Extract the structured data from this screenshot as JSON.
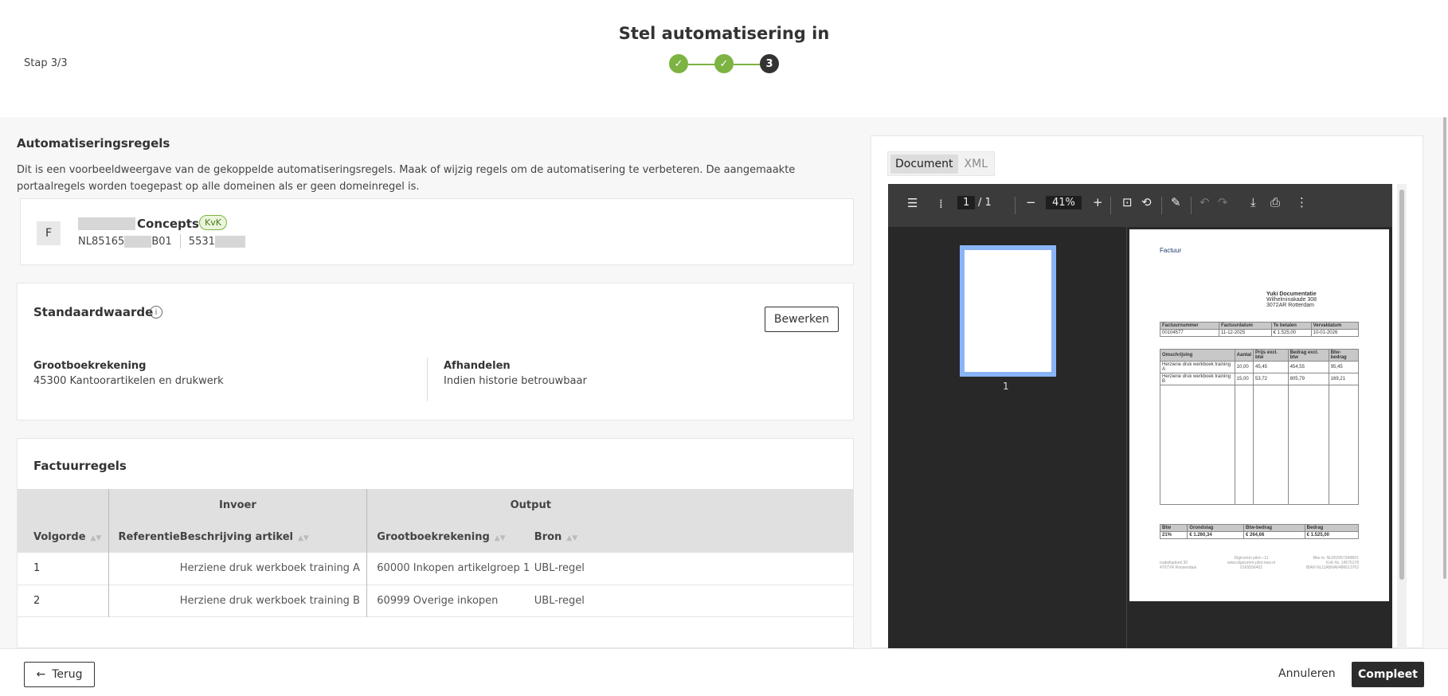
{
  "header": {
    "title": "Stel automatisering in",
    "step": "Stap 3/3",
    "stepper": [
      {
        "state": "done"
      },
      {
        "state": "done"
      },
      {
        "state": "current",
        "label": "3"
      }
    ]
  },
  "rules": {
    "title": "Automatiseringsregels",
    "description": "Dit is een voorbeeldweergave van de gekoppelde automatiseringsregels. Maak of wijzig regels om de automatisering te verbeteren. De aangemaakte portaalregels worden toegepast op alle domeinen als er geen domeinregel is."
  },
  "company": {
    "avatar": "F",
    "name": "Concepts",
    "badge": "KvK",
    "vat_prefix": "NL85165",
    "vat_suffix": "B01",
    "kvk_prefix": "5531"
  },
  "defaults": {
    "title": "Standaardwaarde",
    "edit_label": "Bewerken",
    "ledger_label": "Grootboekrekening",
    "ledger_value": "45300 Kantoorartikelen en drukwerk",
    "handling_label": "Afhandelen",
    "handling_value": "Indien historie betrouwbaar"
  },
  "lines": {
    "title": "Factuurregels",
    "group_input": "Invoer",
    "group_output": "Output",
    "columns": [
      "Volgorde",
      "Referentie",
      "Beschrijving artikel",
      "Grootboekrekening",
      "Bron"
    ],
    "rows": [
      {
        "order": "1",
        "reference": "",
        "description": "Herziene druk werkboek training A",
        "ledger": "60000 Inkopen artikelgroep 1",
        "source": "UBL-regel"
      },
      {
        "order": "2",
        "reference": "",
        "description": "Herziene druk werkboek training B",
        "ledger": "60999 Overige inkopen",
        "source": "UBL-regel"
      }
    ]
  },
  "viewer": {
    "tabs": [
      "Document",
      "XML"
    ],
    "active_tab": "Document",
    "page": "1",
    "page_total": "/ 1",
    "zoom": "41%",
    "thumb_label": "1"
  },
  "invoice": {
    "heading": "Factuur",
    "company": "Yuki Documentatie",
    "address1": "Wilhelminakade 308",
    "address2": "3072AR  Rotterdam",
    "meta_headers": [
      "Factuurnummer",
      "Factuurdatum",
      "Te betalen",
      "Vervaldatum"
    ],
    "meta_values": [
      "00104577",
      "11-12-2025",
      "€ 1.525,00",
      "10-01-2026"
    ],
    "line_headers": [
      "Omschrijving",
      "Aantal",
      "Prijs excl. btw",
      "Bedrag excl. btw",
      "Btw-bedrag"
    ],
    "line_rows": [
      [
        "Herziene druk werkboek training A",
        "10,00",
        "45,45",
        "454,55",
        "95,45"
      ],
      [
        "Herziene druk werkboek training B",
        "15,00",
        "53,72",
        "805,79",
        "169,21"
      ]
    ],
    "vat_headers": [
      "Btw",
      "Grondslag",
      "Btw-bedrag",
      "Bedrag"
    ],
    "vat_values": [
      "21%",
      "€ 1.260,34",
      "€ 264,66",
      "€ 1.525,00"
    ],
    "footer_left": [
      "Isabelladonk 30",
      "4707VR Roosendaal"
    ],
    "footer_mid": [
      "Digicomm pilot—11",
      "www.digicomm-pilot-new.nl",
      "0165556402"
    ],
    "footer_right": [
      "Btw-nr. NL852957349B01",
      "KvK-Nr. 14575178",
      "IBAN NL11ABNA0486613763"
    ]
  },
  "footer": {
    "back_label": "Terug",
    "cancel_label": "Annuleren",
    "complete_label": "Compleet"
  }
}
